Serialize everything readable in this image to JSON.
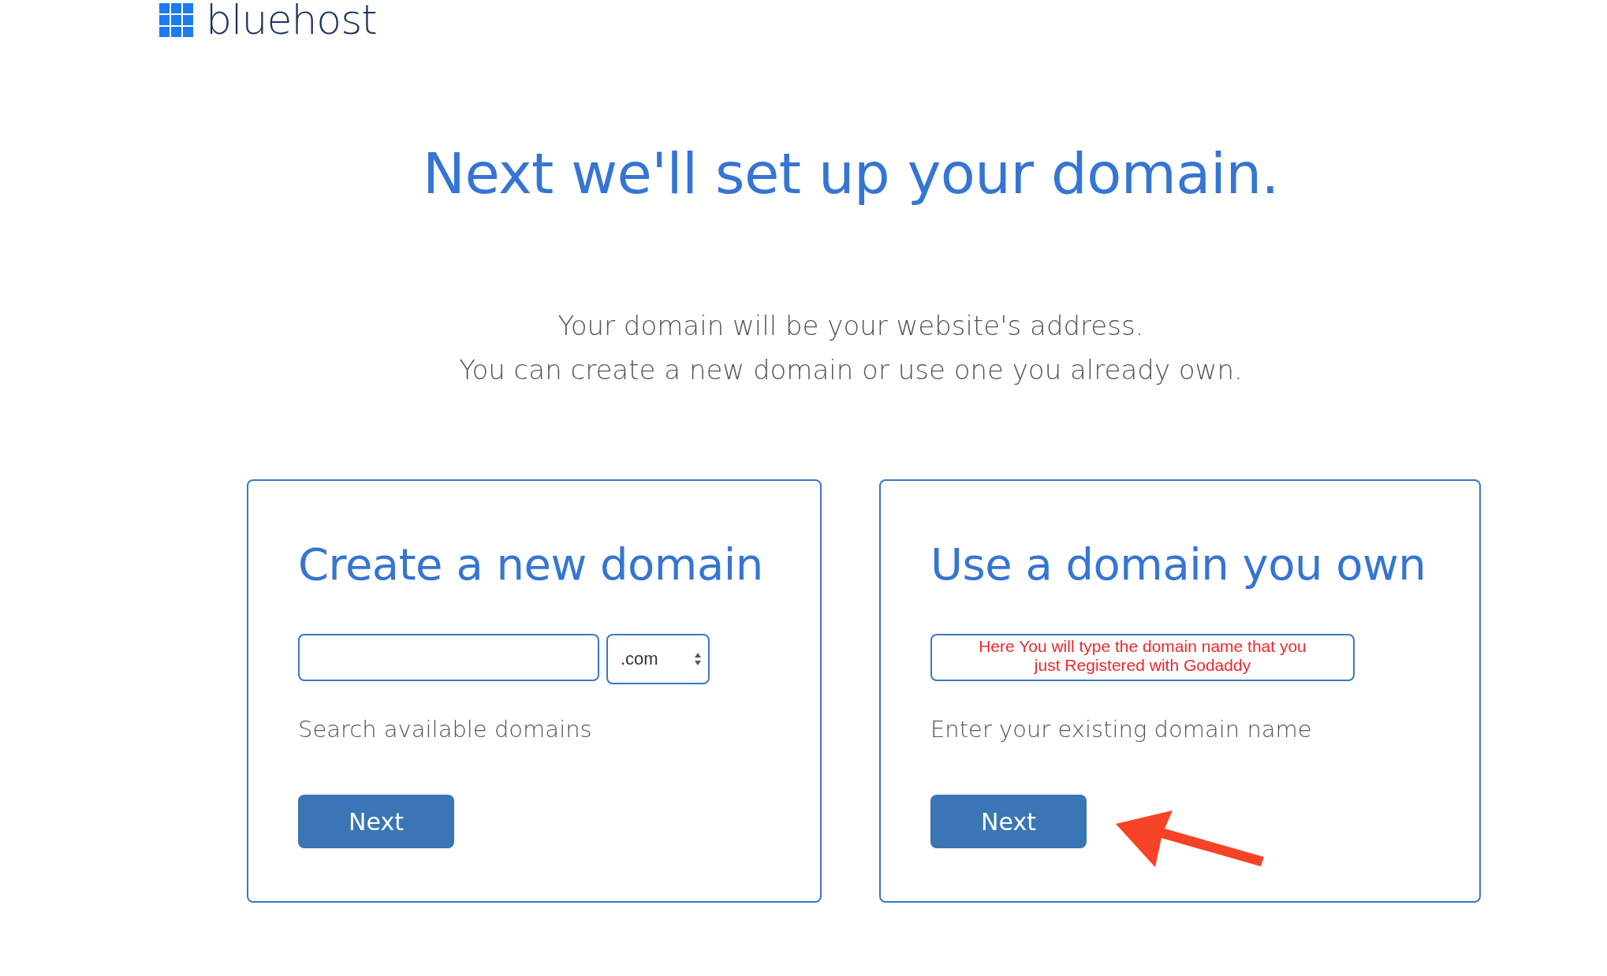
{
  "logo": {
    "text": "bluehost"
  },
  "heading": "Next we'll set up your domain.",
  "subtitle": [
    "Your domain will be your website's address.",
    "You can create a new domain or use one you already own."
  ],
  "cards": [
    {
      "kind": "search",
      "title": "Create a new domain",
      "tld": ".com",
      "help": "Search available domains",
      "button": "Next"
    },
    {
      "kind": "existing",
      "title": "Use a domain you own",
      "value": "Here You will type the domain name that you just Registered with Godaddy",
      "help": "Enter your existing domain name",
      "button": "Next"
    }
  ]
}
